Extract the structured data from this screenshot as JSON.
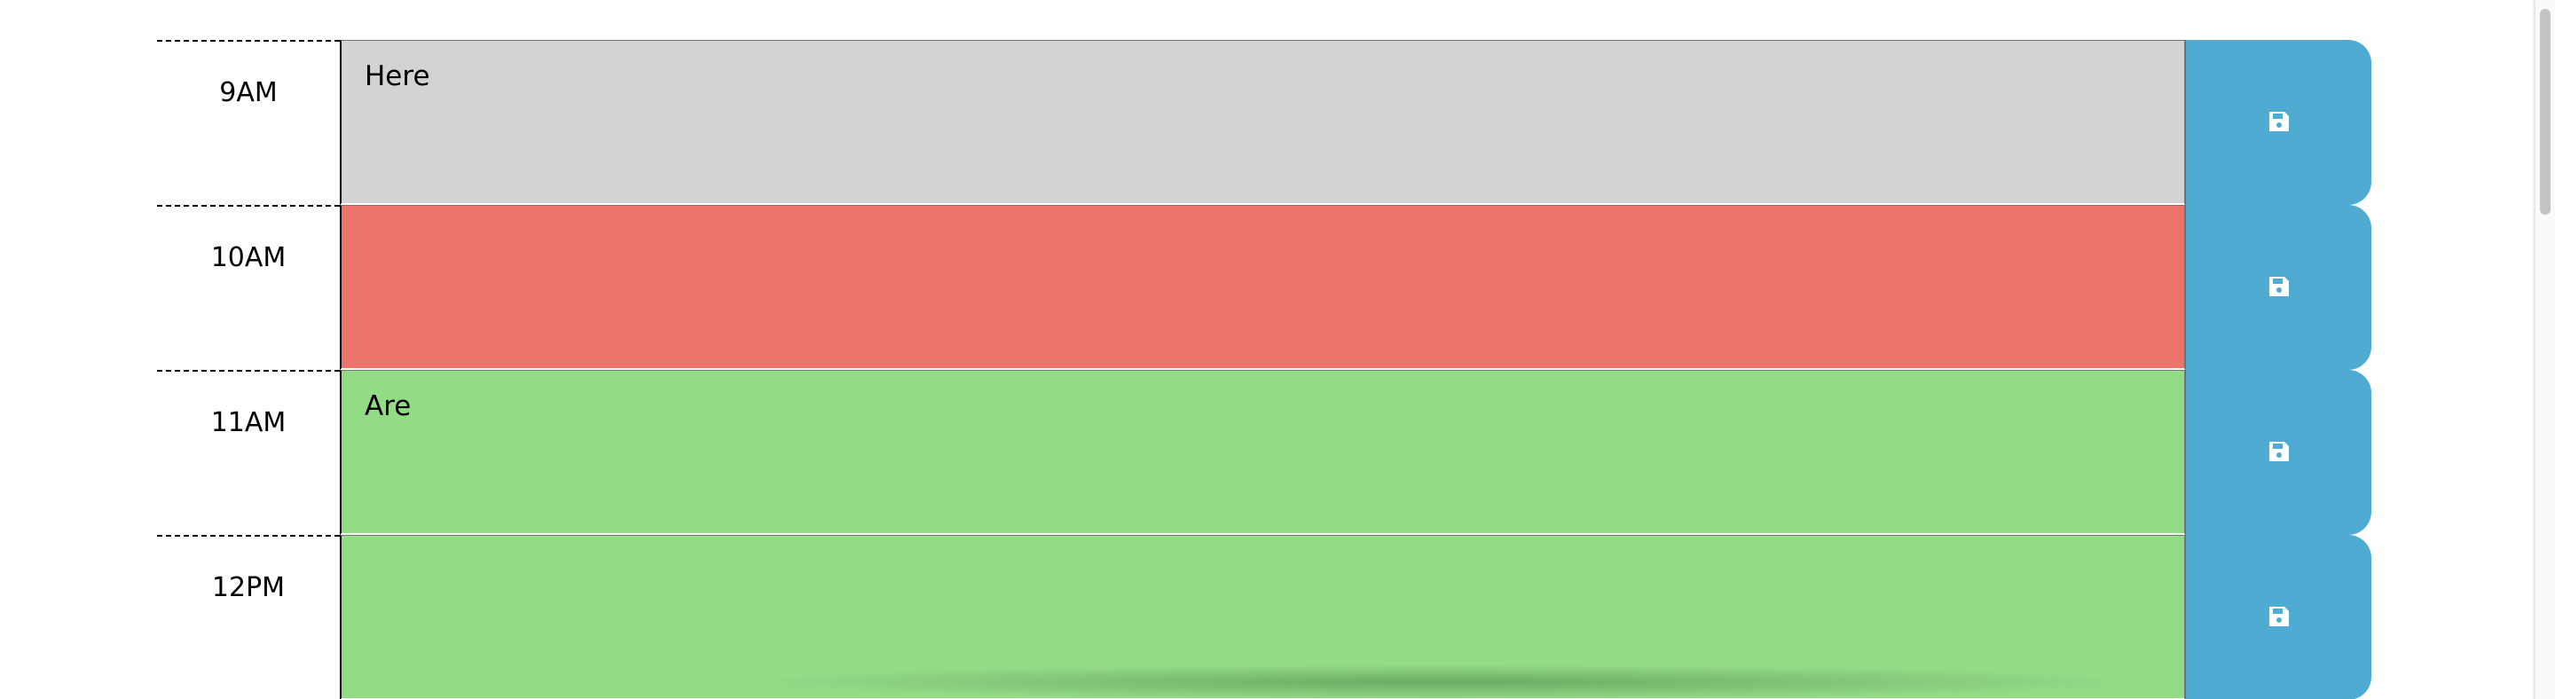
{
  "planner": {
    "rows": [
      {
        "hour": "9AM",
        "text": "Here",
        "state": "past",
        "color": "#d3d3d3"
      },
      {
        "hour": "10AM",
        "text": "",
        "state": "present",
        "color": "#ed746a"
      },
      {
        "hour": "11AM",
        "text": "Are",
        "state": "future",
        "color": "#93dc86"
      },
      {
        "hour": "12PM",
        "text": "",
        "state": "future",
        "color": "#93dc86"
      }
    ],
    "save_icon": "floppy-disk-icon",
    "save_color": "#4fabd2"
  }
}
